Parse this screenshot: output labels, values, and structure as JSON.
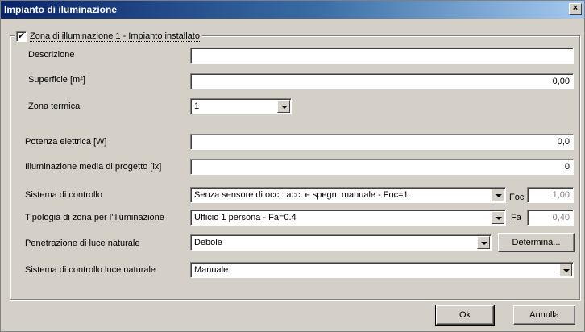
{
  "window": {
    "title": "Impianto di iluminazione",
    "close_glyph": "×"
  },
  "group": {
    "checked": true,
    "check_glyph": "✔",
    "label": "Zona di illuminazione 1 - Impianto installato"
  },
  "fields": {
    "descrizione_label": "Descrizione",
    "descrizione_value": "",
    "superficie_label": "Superficie [m²]",
    "superficie_value": "0,00",
    "zona_termica_label": "Zona termica",
    "zona_termica_value": "1",
    "potenza_label": "Potenza elettrica [W]",
    "potenza_value": "0,0",
    "illuminazione_label": "Illuminazione media di progetto [lx]",
    "illuminazione_value": "0",
    "sistema_controllo_label": "Sistema di controllo",
    "sistema_controllo_value": "Senza sensore di occ.: acc. e spegn. manuale - Foc=1",
    "foc_label": "Foc",
    "foc_value": "1,00",
    "tipologia_label": "Tipologia di zona per l'illuminazione",
    "tipologia_value": "Ufficio 1 persona - Fa=0.4",
    "fa_label": "Fa",
    "fa_value": "0,40",
    "penetrazione_label": "Penetrazione di luce naturale",
    "penetrazione_value": "Debole",
    "determina_label": "Determina...",
    "sistema_luce_label": "Sistema di controllo  luce naturale",
    "sistema_luce_value": "Manuale"
  },
  "buttons": {
    "ok": "Ok",
    "annulla": "Annulla"
  }
}
